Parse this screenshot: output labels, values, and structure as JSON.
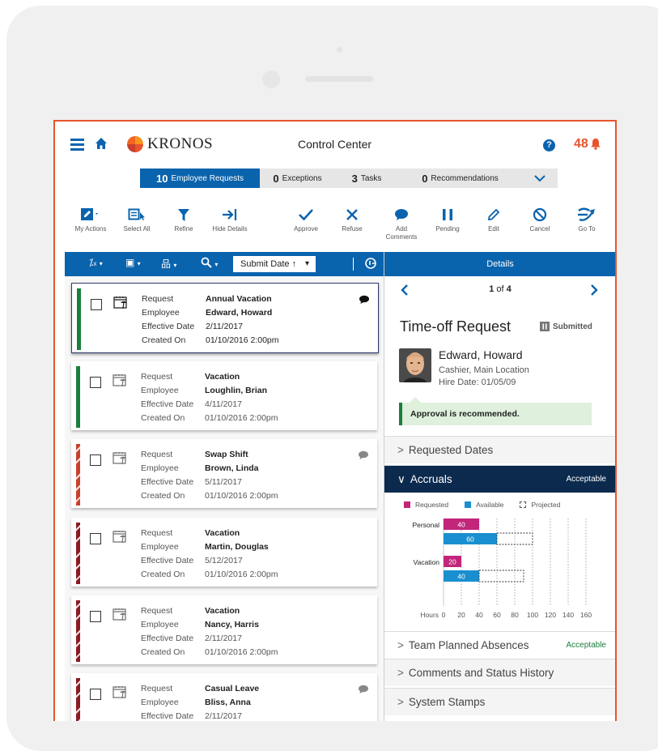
{
  "header": {
    "logo_text": "KRONOS",
    "title": "Control Center",
    "help_label": "?",
    "alert_count": "48"
  },
  "tabs": [
    {
      "count": "10",
      "label": "Employee Requests",
      "active": true
    },
    {
      "count": "0",
      "label": "Exceptions",
      "active": false
    },
    {
      "count": "3",
      "label": "Tasks",
      "active": false
    },
    {
      "count": "0",
      "label": "Recommendations",
      "active": false
    }
  ],
  "toolbar": {
    "my_actions": "My Actions",
    "select_all": "Select All",
    "refine": "Refine",
    "hide_details": "Hide Details",
    "approve": "Approve",
    "refuse": "Refuse",
    "add_comments": "Add Comments",
    "pending": "Pending",
    "edit": "Edit",
    "cancel": "Cancel",
    "go_to": "Go To"
  },
  "listbar": {
    "sort_label": "Submit Date ↑",
    "sort_caret": "▾"
  },
  "field_labels": {
    "request": "Request",
    "employee": "Employee",
    "effective_date": "Effective Date",
    "created_on": "Created On"
  },
  "requests": [
    {
      "request": "Annual Vacation",
      "employee": "Edward, Howard",
      "effective_date": "2/11/2017",
      "created_on": "01/10/2016  2:00pm",
      "status_color": "#1a7f3c",
      "has_comment": true,
      "selected": true
    },
    {
      "request": "Vacation",
      "employee": "Loughlin, Brian",
      "effective_date": "4/11/2017",
      "created_on": "01/10/2016  2:00pm",
      "status_color": "#1a7f3c",
      "has_comment": false,
      "selected": false
    },
    {
      "request": "Swap Shift",
      "employee": "Brown, Linda",
      "effective_date": "5/11/2017",
      "created_on": "01/10/2016  2:00pm",
      "status_color": "#c9412b",
      "has_comment": true,
      "selected": false
    },
    {
      "request": "Vacation",
      "employee": "Martin, Douglas",
      "effective_date": "5/12/2017",
      "created_on": "01/10/2016  2:00pm",
      "status_color": "#8b1c24",
      "has_comment": false,
      "selected": false
    },
    {
      "request": "Vacation",
      "employee": "Nancy, Harris",
      "effective_date": "2/11/2017",
      "created_on": "01/10/2016  2:00pm",
      "status_color": "#8b1c24",
      "has_comment": false,
      "selected": false
    },
    {
      "request": "Casual Leave",
      "employee": "Bliss, Anna",
      "effective_date": "2/11/2017",
      "created_on": "",
      "status_color": "#8b1c24",
      "has_comment": true,
      "selected": false
    }
  ],
  "details": {
    "header": "Details",
    "pager_current": "1",
    "pager_of": "of",
    "pager_total": "4",
    "title": "Time-off Request",
    "status": "Submitted",
    "employee_name": "Edward, Howard",
    "employee_role": "Cashier, Main Location",
    "hire_date": "Hire Date: 01/05/09",
    "recommendation": "Approval is recommended.",
    "sections": [
      {
        "label": "Requested Dates",
        "status": ""
      },
      {
        "label": "Accruals",
        "status": "Acceptable"
      },
      {
        "label": "Team Planned Absences",
        "status": "Acceptable"
      },
      {
        "label": "Comments and Status History",
        "status": ""
      },
      {
        "label": "System Stamps",
        "status": ""
      }
    ]
  },
  "colors": {
    "accent": "#0a63ad",
    "alert": "#e8542d",
    "requested": "#c2257a",
    "available": "#1a8fd0",
    "success": "#1a7f3c"
  },
  "chart_data": {
    "type": "bar",
    "orientation": "horizontal",
    "categories": [
      "Personal",
      "Vacation"
    ],
    "series": [
      {
        "name": "Requested",
        "values": [
          40,
          20
        ]
      },
      {
        "name": "Available",
        "values": [
          60,
          40
        ]
      },
      {
        "name": "Projected",
        "values": [
          100,
          90
        ]
      }
    ],
    "xlabel": "Hours",
    "xlim": [
      0,
      160
    ],
    "xticks": [
      0,
      20,
      40,
      60,
      80,
      100,
      120,
      140,
      160
    ],
    "grid": true,
    "legend": "top"
  }
}
